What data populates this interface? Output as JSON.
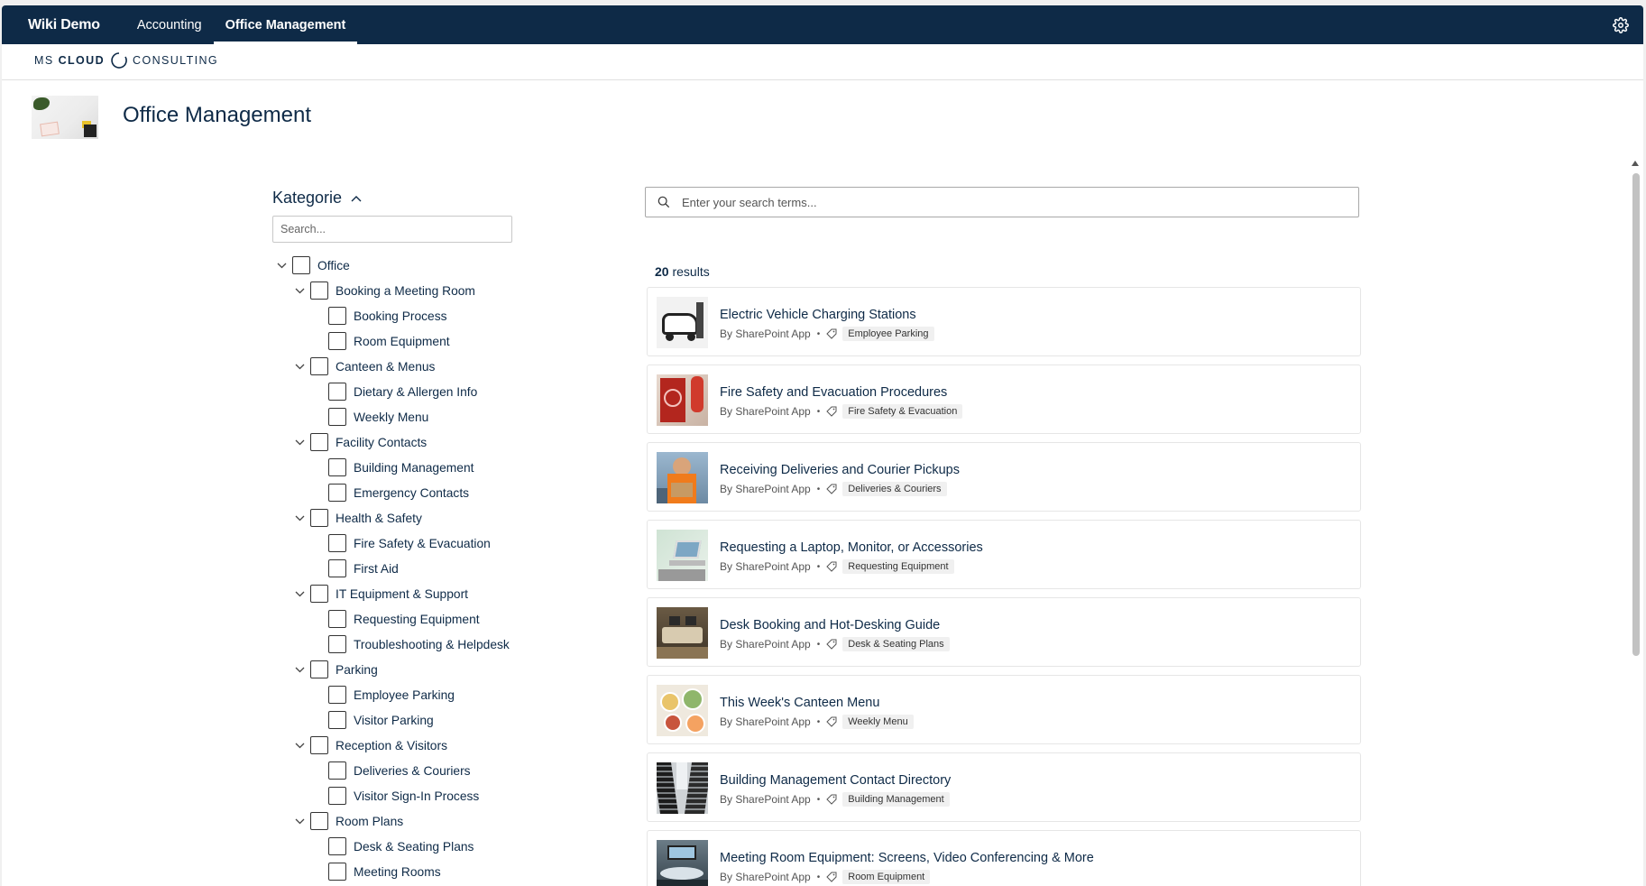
{
  "suitebar": {
    "title": "Wiki Demo",
    "nav": [
      {
        "label": "Accounting",
        "active": false
      },
      {
        "label": "Office Management",
        "active": true
      }
    ],
    "settings_icon": "gear-icon"
  },
  "logo": {
    "part1": "MS",
    "part2": "CLOUD",
    "part3": "CONSULTING"
  },
  "page": {
    "title": "Office Management"
  },
  "filter": {
    "heading": "Kategorie",
    "search_placeholder": "Search...",
    "tree": [
      {
        "label": "Office",
        "level": 0,
        "expanded": true
      },
      {
        "label": "Booking a Meeting Room",
        "level": 1,
        "expanded": true
      },
      {
        "label": "Booking Process",
        "level": 2
      },
      {
        "label": "Room Equipment",
        "level": 2
      },
      {
        "label": "Canteen & Menus",
        "level": 1,
        "expanded": true
      },
      {
        "label": "Dietary & Allergen Info",
        "level": 2
      },
      {
        "label": "Weekly Menu",
        "level": 2
      },
      {
        "label": "Facility Contacts",
        "level": 1,
        "expanded": true
      },
      {
        "label": "Building Management",
        "level": 2
      },
      {
        "label": "Emergency Contacts",
        "level": 2
      },
      {
        "label": "Health & Safety",
        "level": 1,
        "expanded": true
      },
      {
        "label": "Fire Safety & Evacuation",
        "level": 2
      },
      {
        "label": "First Aid",
        "level": 2
      },
      {
        "label": "IT Equipment & Support",
        "level": 1,
        "expanded": true
      },
      {
        "label": "Requesting Equipment",
        "level": 2
      },
      {
        "label": "Troubleshooting & Helpdesk",
        "level": 2
      },
      {
        "label": "Parking",
        "level": 1,
        "expanded": true
      },
      {
        "label": "Employee Parking",
        "level": 2
      },
      {
        "label": "Visitor Parking",
        "level": 2
      },
      {
        "label": "Reception & Visitors",
        "level": 1,
        "expanded": true
      },
      {
        "label": "Deliveries & Couriers",
        "level": 2
      },
      {
        "label": "Visitor Sign-In Process",
        "level": 2
      },
      {
        "label": "Room Plans",
        "level": 1,
        "expanded": true
      },
      {
        "label": "Desk & Seating Plans",
        "level": 2
      },
      {
        "label": "Meeting Rooms",
        "level": 2
      }
    ]
  },
  "results": {
    "search_placeholder": "Enter your search terms...",
    "count": "20",
    "count_suffix": "results",
    "items": [
      {
        "title": "Electric Vehicle Charging Stations",
        "author": "By SharePoint App",
        "tag": "Employee Parking",
        "thumb": "ev"
      },
      {
        "title": "Fire Safety and Evacuation Procedures",
        "author": "By SharePoint App",
        "tag": "Fire Safety & Evacuation",
        "thumb": "fire"
      },
      {
        "title": "Receiving Deliveries and Courier Pickups",
        "author": "By SharePoint App",
        "tag": "Deliveries & Couriers",
        "thumb": "courier"
      },
      {
        "title": "Requesting a Laptop, Monitor, or Accessories",
        "author": "By SharePoint App",
        "tag": "Requesting Equipment",
        "thumb": "laptop"
      },
      {
        "title": "Desk Booking and Hot-Desking Guide",
        "author": "By SharePoint App",
        "tag": "Desk & Seating Plans",
        "thumb": "desk"
      },
      {
        "title": "This Week's Canteen Menu",
        "author": "By SharePoint App",
        "tag": "Weekly Menu",
        "thumb": "food"
      },
      {
        "title": "Building Management Contact Directory",
        "author": "By SharePoint App",
        "tag": "Building Management",
        "thumb": "building"
      },
      {
        "title": "Meeting Room Equipment: Screens, Video Conferencing & More",
        "author": "By SharePoint App",
        "tag": "Room Equipment",
        "thumb": "meeting"
      }
    ]
  },
  "colors": {
    "suitebar": "#0e2a47",
    "text_dark": "#0e2a47",
    "tag_bg": "#f0f0f0"
  }
}
